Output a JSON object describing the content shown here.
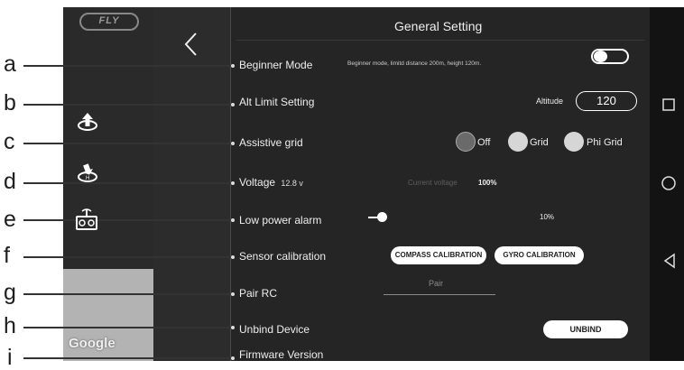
{
  "callouts": [
    "a",
    "b",
    "c",
    "d",
    "e",
    "f",
    "g",
    "h",
    "i"
  ],
  "app": {
    "logo_text": "FLY",
    "map_watermark": "Google",
    "header_title": "General Setting"
  },
  "settings": {
    "beginner_mode": {
      "label": "Beginner Mode",
      "description": "Beginner mode, limitd distance 200m, height 120m.",
      "toggle_on": true
    },
    "alt_limit": {
      "label": "Alt Limit Setting",
      "altitude_label": "Altitude",
      "altitude_value": "120"
    },
    "assistive_grid": {
      "label": "Assistive grid",
      "options": [
        "Off",
        "Grid",
        "Phi Grid"
      ],
      "selected": "Off"
    },
    "voltage": {
      "label": "Voltage",
      "value": "12.8 v",
      "current_label": "Current voltage",
      "current_value": "100%"
    },
    "low_power": {
      "label": "Low power alarm",
      "value": "10%",
      "level_fraction": 0.1
    },
    "sensor": {
      "label": "Sensor calibration",
      "compass_button": "COMPASS CALIBRATION",
      "gyro_button": "GYRO CALIBRATION"
    },
    "pair_rc": {
      "label": "Pair RC",
      "pair_text": "Pair"
    },
    "unbind": {
      "label": "Unbind Device",
      "button": "UNBIND"
    },
    "firmware": {
      "label": "Firmware Version"
    }
  },
  "icons": [
    "back-chevron-icon",
    "takeoff-icon",
    "landing-icon",
    "controller-icon",
    "square-icon",
    "circle-icon",
    "triangle-back-icon"
  ],
  "colors": {
    "panel": "#252525",
    "text": "#eeeeee",
    "button_bg": "#ffffff"
  }
}
